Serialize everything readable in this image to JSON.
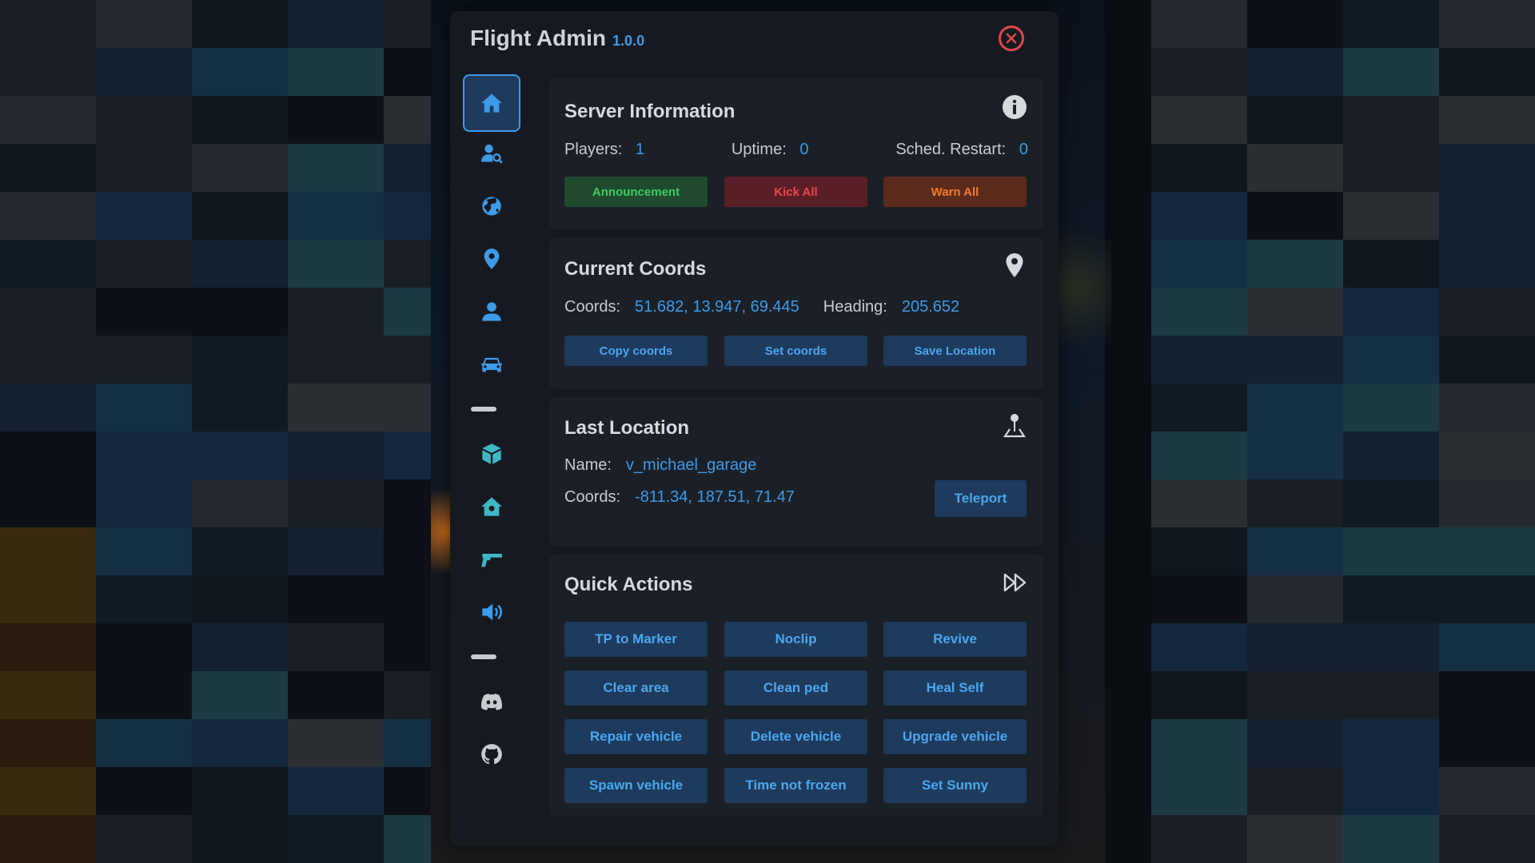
{
  "window": {
    "title": "Flight Admin",
    "version": "1.0.0"
  },
  "sidebar": {
    "items": [
      {
        "icon": "home-icon",
        "active": true
      },
      {
        "icon": "player-search-icon"
      },
      {
        "icon": "globe-icon"
      },
      {
        "icon": "map-pin-icon"
      },
      {
        "icon": "user-icon"
      },
      {
        "icon": "car-icon"
      },
      {
        "icon": "cube-icon"
      },
      {
        "icon": "house-gear-icon"
      },
      {
        "icon": "gun-icon"
      },
      {
        "icon": "volume-icon"
      },
      {
        "icon": "discord-icon"
      },
      {
        "icon": "github-icon"
      }
    ]
  },
  "server_info": {
    "title": "Server Information",
    "players_label": "Players:",
    "players_value": "1",
    "uptime_label": "Uptime:",
    "uptime_value": "0",
    "restart_label": "Sched. Restart:",
    "restart_value": "0",
    "buttons": {
      "announcement": "Announcement",
      "kick_all": "Kick All",
      "warn_all": "Warn All"
    }
  },
  "current_coords": {
    "title": "Current Coords",
    "coords_label": "Coords:",
    "coords_value": "51.682, 13.947, 69.445",
    "heading_label": "Heading:",
    "heading_value": "205.652",
    "buttons": {
      "copy": "Copy coords",
      "set": "Set coords",
      "save": "Save Location"
    }
  },
  "last_location": {
    "title": "Last Location",
    "name_label": "Name:",
    "name_value": "v_michael_garage",
    "coords_label": "Coords:",
    "coords_value": "-811.34, 187.51, 71.47",
    "teleport": "Teleport"
  },
  "quick_actions": {
    "title": "Quick Actions",
    "buttons": [
      "TP to Marker",
      "Noclip",
      "Revive",
      "Clear area",
      "Clean ped",
      "Heal Self",
      "Repair vehicle",
      "Delete vehicle",
      "Upgrade vehicle",
      "Spawn vehicle",
      "Time not frozen",
      "Set Sunny"
    ]
  },
  "colors": {
    "accent": "#3d9be9",
    "panel": "#161a20",
    "card": "#1b2027",
    "danger": "#e0474c",
    "success": "#3ecc62",
    "warning": "#f57a2c"
  }
}
